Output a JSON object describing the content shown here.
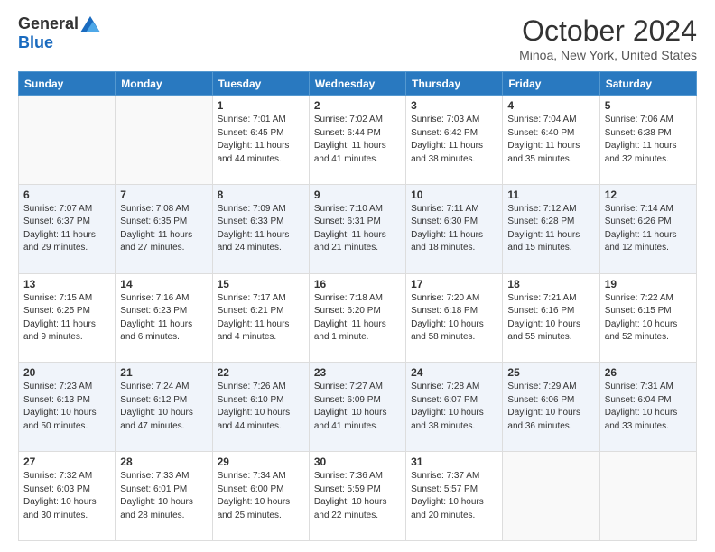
{
  "header": {
    "logo_general": "General",
    "logo_blue": "Blue",
    "month": "October 2024",
    "location": "Minoa, New York, United States"
  },
  "days_of_week": [
    "Sunday",
    "Monday",
    "Tuesday",
    "Wednesday",
    "Thursday",
    "Friday",
    "Saturday"
  ],
  "weeks": [
    [
      {
        "day": "",
        "info": ""
      },
      {
        "day": "",
        "info": ""
      },
      {
        "day": "1",
        "info": "Sunrise: 7:01 AM\nSunset: 6:45 PM\nDaylight: 11 hours and 44 minutes."
      },
      {
        "day": "2",
        "info": "Sunrise: 7:02 AM\nSunset: 6:44 PM\nDaylight: 11 hours and 41 minutes."
      },
      {
        "day": "3",
        "info": "Sunrise: 7:03 AM\nSunset: 6:42 PM\nDaylight: 11 hours and 38 minutes."
      },
      {
        "day": "4",
        "info": "Sunrise: 7:04 AM\nSunset: 6:40 PM\nDaylight: 11 hours and 35 minutes."
      },
      {
        "day": "5",
        "info": "Sunrise: 7:06 AM\nSunset: 6:38 PM\nDaylight: 11 hours and 32 minutes."
      }
    ],
    [
      {
        "day": "6",
        "info": "Sunrise: 7:07 AM\nSunset: 6:37 PM\nDaylight: 11 hours and 29 minutes."
      },
      {
        "day": "7",
        "info": "Sunrise: 7:08 AM\nSunset: 6:35 PM\nDaylight: 11 hours and 27 minutes."
      },
      {
        "day": "8",
        "info": "Sunrise: 7:09 AM\nSunset: 6:33 PM\nDaylight: 11 hours and 24 minutes."
      },
      {
        "day": "9",
        "info": "Sunrise: 7:10 AM\nSunset: 6:31 PM\nDaylight: 11 hours and 21 minutes."
      },
      {
        "day": "10",
        "info": "Sunrise: 7:11 AM\nSunset: 6:30 PM\nDaylight: 11 hours and 18 minutes."
      },
      {
        "day": "11",
        "info": "Sunrise: 7:12 AM\nSunset: 6:28 PM\nDaylight: 11 hours and 15 minutes."
      },
      {
        "day": "12",
        "info": "Sunrise: 7:14 AM\nSunset: 6:26 PM\nDaylight: 11 hours and 12 minutes."
      }
    ],
    [
      {
        "day": "13",
        "info": "Sunrise: 7:15 AM\nSunset: 6:25 PM\nDaylight: 11 hours and 9 minutes."
      },
      {
        "day": "14",
        "info": "Sunrise: 7:16 AM\nSunset: 6:23 PM\nDaylight: 11 hours and 6 minutes."
      },
      {
        "day": "15",
        "info": "Sunrise: 7:17 AM\nSunset: 6:21 PM\nDaylight: 11 hours and 4 minutes."
      },
      {
        "day": "16",
        "info": "Sunrise: 7:18 AM\nSunset: 6:20 PM\nDaylight: 11 hours and 1 minute."
      },
      {
        "day": "17",
        "info": "Sunrise: 7:20 AM\nSunset: 6:18 PM\nDaylight: 10 hours and 58 minutes."
      },
      {
        "day": "18",
        "info": "Sunrise: 7:21 AM\nSunset: 6:16 PM\nDaylight: 10 hours and 55 minutes."
      },
      {
        "day": "19",
        "info": "Sunrise: 7:22 AM\nSunset: 6:15 PM\nDaylight: 10 hours and 52 minutes."
      }
    ],
    [
      {
        "day": "20",
        "info": "Sunrise: 7:23 AM\nSunset: 6:13 PM\nDaylight: 10 hours and 50 minutes."
      },
      {
        "day": "21",
        "info": "Sunrise: 7:24 AM\nSunset: 6:12 PM\nDaylight: 10 hours and 47 minutes."
      },
      {
        "day": "22",
        "info": "Sunrise: 7:26 AM\nSunset: 6:10 PM\nDaylight: 10 hours and 44 minutes."
      },
      {
        "day": "23",
        "info": "Sunrise: 7:27 AM\nSunset: 6:09 PM\nDaylight: 10 hours and 41 minutes."
      },
      {
        "day": "24",
        "info": "Sunrise: 7:28 AM\nSunset: 6:07 PM\nDaylight: 10 hours and 38 minutes."
      },
      {
        "day": "25",
        "info": "Sunrise: 7:29 AM\nSunset: 6:06 PM\nDaylight: 10 hours and 36 minutes."
      },
      {
        "day": "26",
        "info": "Sunrise: 7:31 AM\nSunset: 6:04 PM\nDaylight: 10 hours and 33 minutes."
      }
    ],
    [
      {
        "day": "27",
        "info": "Sunrise: 7:32 AM\nSunset: 6:03 PM\nDaylight: 10 hours and 30 minutes."
      },
      {
        "day": "28",
        "info": "Sunrise: 7:33 AM\nSunset: 6:01 PM\nDaylight: 10 hours and 28 minutes."
      },
      {
        "day": "29",
        "info": "Sunrise: 7:34 AM\nSunset: 6:00 PM\nDaylight: 10 hours and 25 minutes."
      },
      {
        "day": "30",
        "info": "Sunrise: 7:36 AM\nSunset: 5:59 PM\nDaylight: 10 hours and 22 minutes."
      },
      {
        "day": "31",
        "info": "Sunrise: 7:37 AM\nSunset: 5:57 PM\nDaylight: 10 hours and 20 minutes."
      },
      {
        "day": "",
        "info": ""
      },
      {
        "day": "",
        "info": ""
      }
    ]
  ]
}
